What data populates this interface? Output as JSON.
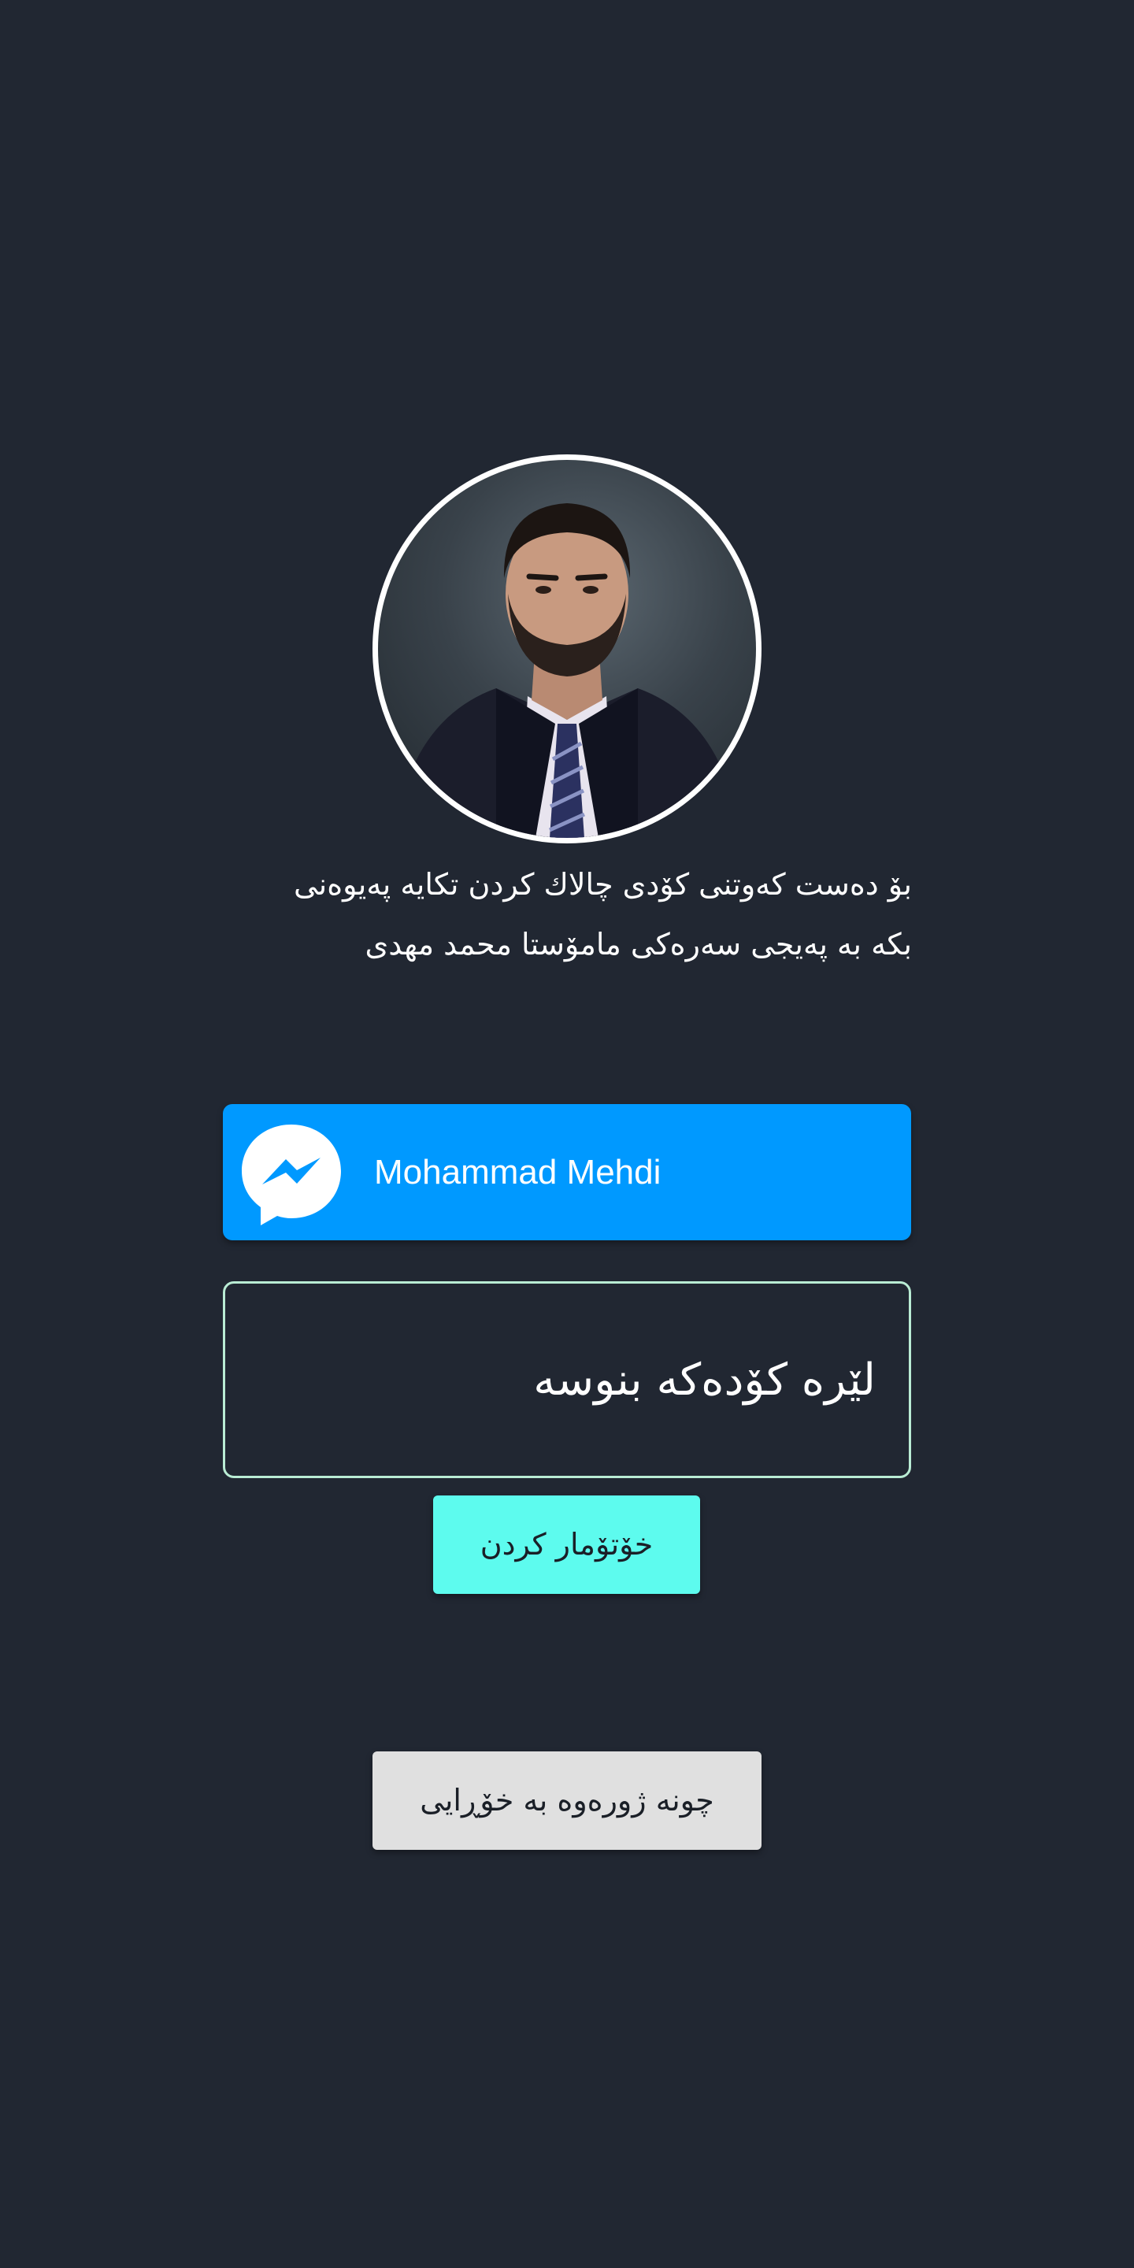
{
  "profile": {
    "avatar_alt": "Mohammad Mehdi"
  },
  "message": {
    "text": "بۆ دەست کەوتنی کۆدی چالاك کردن تکایە پەیوەنی بکە بە پەیجی سەرەکی مامۆستا محمد مهدی"
  },
  "messenger_button": {
    "label": "Mohammad Mehdi",
    "icon": "messenger-icon",
    "color": "#0099ff"
  },
  "code_field": {
    "placeholder": "لێرە کۆدەکە بنوسە",
    "value": ""
  },
  "register_button": {
    "label": "خۆتۆمار کردن",
    "color": "#5dfbee"
  },
  "login_button": {
    "label": "چونە ژورەوە بە خۆڕایی",
    "color": "#e0e0e0"
  },
  "colors": {
    "background": "#212732"
  }
}
